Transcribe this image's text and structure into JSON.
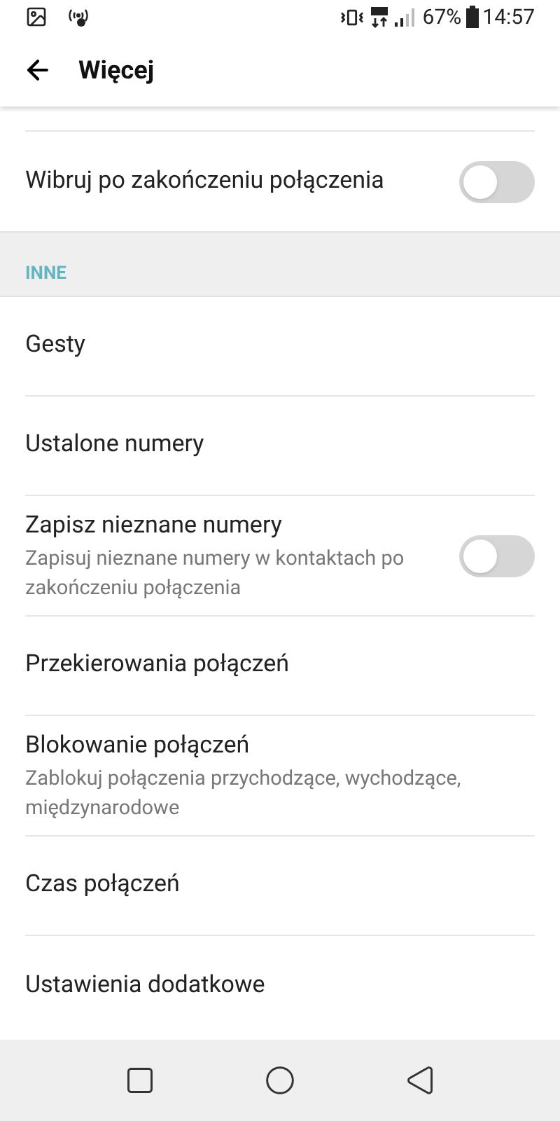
{
  "status_bar": {
    "battery": "67%",
    "time": "14:57"
  },
  "toolbar": {
    "title": "Więcej"
  },
  "rows_top": [
    {
      "kind": "switch",
      "title": "Wibruj po zakończeniu połączenia",
      "on": false
    }
  ],
  "section": {
    "title": "INNE"
  },
  "rows": [
    {
      "kind": "plain",
      "title": "Gesty"
    },
    {
      "kind": "plain",
      "title": "Ustalone numery"
    },
    {
      "kind": "switch",
      "title": "Zapisz nieznane numery",
      "subtitle": "Zapisuj nieznane numery w kontaktach po zakończeniu połączenia",
      "on": false
    },
    {
      "kind": "plain",
      "title": "Przekierowania połączeń"
    },
    {
      "kind": "plain",
      "title": "Blokowanie połączeń",
      "subtitle": "Zablokuj połączenia przychodzące, wychodzące, międzynarodowe"
    },
    {
      "kind": "plain",
      "title": "Czas połączeń"
    },
    {
      "kind": "plain",
      "title": "Ustawienia dodatkowe"
    }
  ]
}
